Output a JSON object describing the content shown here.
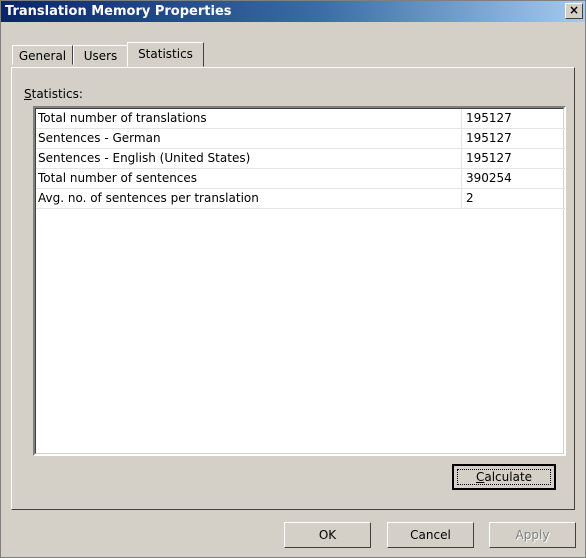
{
  "window": {
    "title": "Translation Memory Properties",
    "close_label": "×"
  },
  "tabs": [
    {
      "label": "General"
    },
    {
      "label": "Users"
    },
    {
      "label": "Statistics",
      "active": true
    }
  ],
  "statistics": {
    "label": "Statistics:",
    "rows": [
      {
        "name": "Total number of translations",
        "value": "195127"
      },
      {
        "name": "Sentences - German",
        "value": "195127"
      },
      {
        "name": "Sentences - English (United States)",
        "value": "195127"
      },
      {
        "name": "Total number of sentences",
        "value": "390254"
      },
      {
        "name": "Avg. no. of sentences per translation",
        "value": "2"
      }
    ],
    "calculate_label": "Calculate"
  },
  "footer": {
    "ok_label": "OK",
    "cancel_label": "Cancel",
    "apply_label": "Apply"
  }
}
